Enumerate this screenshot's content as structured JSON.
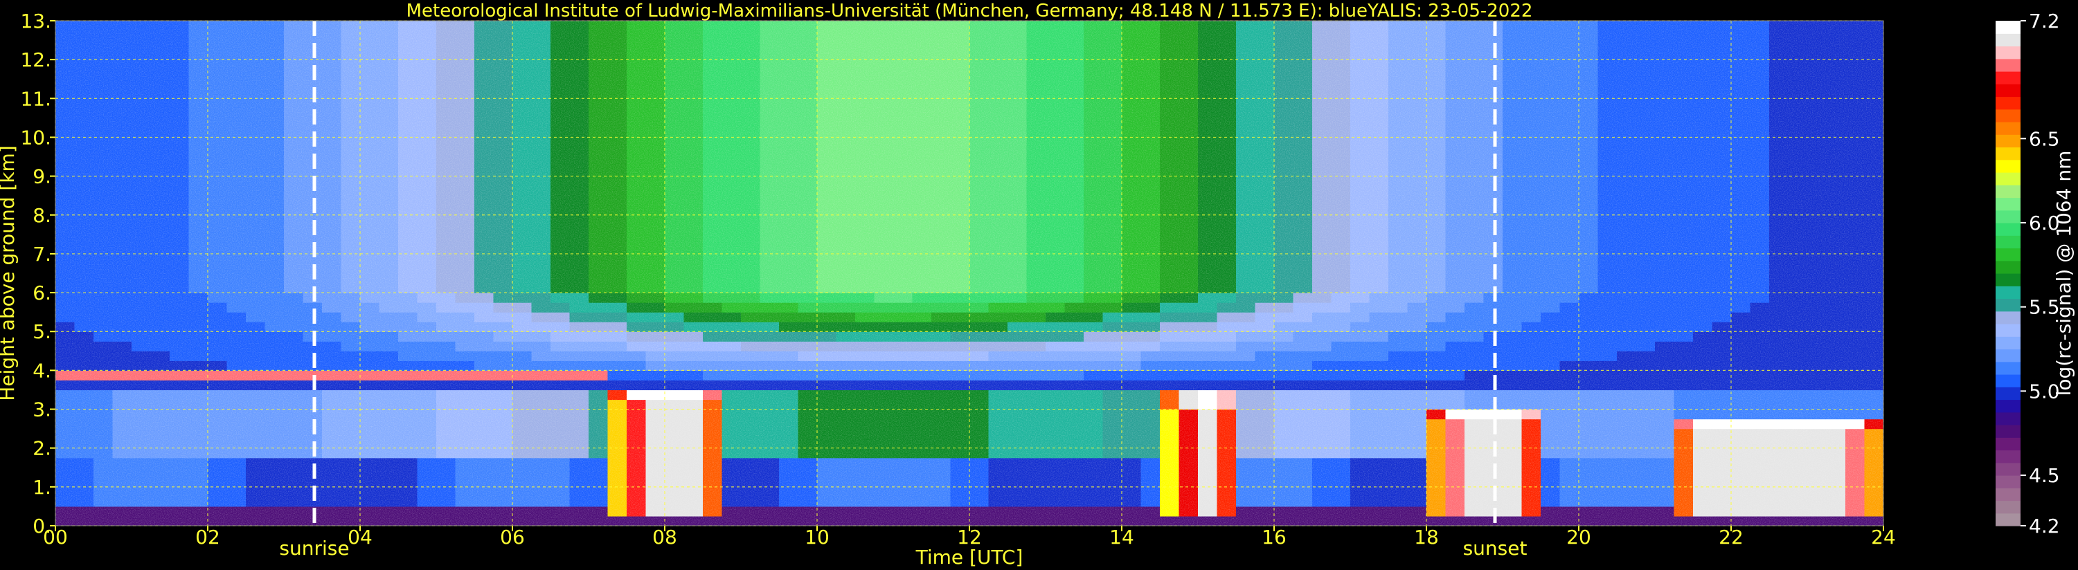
{
  "chart_data": {
    "type": "heatmap",
    "title": "Meteorological Institute of Ludwig-Maximilians-Universität (München, Germany; 48.148 N / 11.573 E):     blueYALIS: 23-05-2022",
    "xlabel": "Time [UTC]",
    "ylabel": "Height above ground [km]",
    "colorbar_label": "log(rc-signal) @ 1064 nm",
    "xlim": [
      0,
      24
    ],
    "ylim": [
      0,
      13
    ],
    "clim": [
      4.2,
      7.2
    ],
    "grid": true,
    "x_ticks": [
      0,
      2,
      4,
      6,
      8,
      10,
      12,
      14,
      16,
      18,
      20,
      22,
      24
    ],
    "x_tick_labels": [
      "00",
      "02",
      "04",
      "06",
      "08",
      "10",
      "12",
      "14",
      "16",
      "18",
      "20",
      "22",
      "24"
    ],
    "y_ticks": [
      0,
      1,
      2,
      3,
      4,
      5,
      6,
      7,
      8,
      9,
      10,
      11,
      12,
      13
    ],
    "y_tick_labels": [
      "0.",
      "1.",
      "2.",
      "3.",
      "4.",
      "5.",
      "6.",
      "7.",
      "8.",
      "9.",
      "10.",
      "11.",
      "12.",
      "13."
    ],
    "colorbar_ticks": [
      4.2,
      4.5,
      5.0,
      5.5,
      6.0,
      6.5,
      7.2
    ],
    "colorbar_tick_labels": [
      "4.2",
      "4.5",
      "5.0",
      "5.5",
      "6.0",
      "6.5",
      "7.2"
    ],
    "colorbar_colors": [
      "#a8919f",
      "#a07e95",
      "#9e6c91",
      "#93578c",
      "#874485",
      "#7a2e80",
      "#6a1a78",
      "#4e0f78",
      "#3a0d8a",
      "#2310a8",
      "#1530d0",
      "#1e60ff",
      "#3f82ff",
      "#6a9cff",
      "#86adff",
      "#a0baff",
      "#9fb1e8",
      "#2ba197",
      "#1fb59d",
      "#0d8a26",
      "#1fa51f",
      "#29c12d",
      "#2fd152",
      "#34de6f",
      "#57e67f",
      "#78ef86",
      "#a2f07b",
      "#d7ff3b",
      "#ffff00",
      "#ffd400",
      "#ffa100",
      "#ff7f00",
      "#ff5b00",
      "#ff2600",
      "#ee0000",
      "#ff1a1a",
      "#ff6f76",
      "#ffc0c4",
      "#e6e6e6",
      "#ffffff"
    ],
    "events": [
      {
        "label": "sunrise",
        "time": 3.4
      },
      {
        "label": "sunset",
        "time": 18.9
      }
    ],
    "features": [
      {
        "kind": "boundary_layer_top",
        "time_start": 0,
        "time_end": 7,
        "height_km": 3.8
      },
      {
        "kind": "convective_cloud",
        "time_start": 7.3,
        "time_end": 8.8,
        "base_km": 0.2,
        "top_km": 3.6
      },
      {
        "kind": "cloud",
        "time_start": 14.6,
        "time_end": 15.6,
        "base_km": 0.2,
        "top_km": 3.4
      },
      {
        "kind": "cloud",
        "time_start": 18.0,
        "time_end": 19.6,
        "base_km": 0.2,
        "top_km": 3.0
      },
      {
        "kind": "cloud",
        "time_start": 21.2,
        "time_end": 24.0,
        "base_km": 0.2,
        "top_km": 2.8
      }
    ]
  }
}
